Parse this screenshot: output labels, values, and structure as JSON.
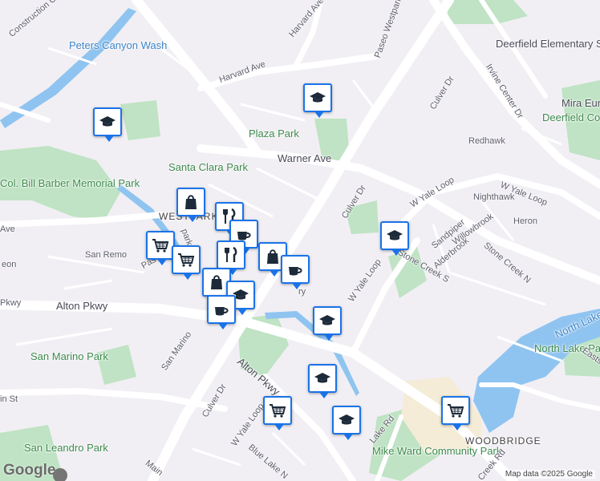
{
  "colors": {
    "background": "#f1eff4",
    "road": "#ffffff",
    "park": "#bfe3c4",
    "water": "#8fc4f0",
    "campus": "#f4ecd6",
    "pin_border": "#1a73e8",
    "pin_icon": "#1d2a3a"
  },
  "labels": {
    "peters_canyon": "Peters Canyon Wash",
    "construction": "Construction Ci",
    "harvard_ave_1": "Harvard Ave",
    "harvard_ave_2": "Harvard Ave",
    "paseo_westpark": "Paseo Westpark",
    "culver_dr_top": "Culver Dr",
    "irvine_center": "Irvine Center Dr",
    "deerfield_school": "Deerfield Elementary School",
    "mira_school": "Mira European Sc",
    "deerfield_park": "Deerfield Community Park",
    "redhawk": "Redhawk",
    "plaza_park": "Plaza Park",
    "warner_ave": "Warner Ave",
    "santa_clara_park": "Santa Clara Park",
    "col_bill_park": "Col. Bill Barber Memorial Park",
    "westpark": "WESTPARK",
    "ave_left": "Ave",
    "culver_dr_mid": "Culver Dr",
    "w_yale_loop_top": "W Yale Loop",
    "w_yale_loop_right": "W Yale Loop",
    "nighthawk": "Nighthawk",
    "sandpiper": "Sandpiper",
    "willowbrook": "Willowbrook",
    "heron": "Heron",
    "alderbrook": "Alderbrook",
    "stone_creek_s": "Stone Creek S",
    "stone_creek_n": "Stone Creek N",
    "san_remo": "San Remo",
    "paseo_left": "Pas",
    "leon": "eon",
    "w_yale_loop_mid": "W Yale Loop",
    "alton_pkwy_left": "Alton Pkwy",
    "alton_pkwy_mid": "Alton Pkwy",
    "pkwy": "Pkwy",
    "north_lake": "North Lake",
    "north_lake_park": "North Lake Park",
    "san_marino_park": "San Marino Park",
    "san_marino": "San Marino",
    "culver_dr_low": "Culver Dr",
    "eastshore": "Eastsh",
    "w_yale_loop_low": "W Yale Loop",
    "lake_rd": "Lake Rd",
    "woodbridge": "WOODBRIDGE",
    "mike_ward_park": "Mike Ward Community Park",
    "blue_lake": "Blue Lake N",
    "san_leandro_park": "San Leandro Park",
    "main": "Main",
    "in_st": "in St",
    "creek_rd": "Creek Rd",
    "park_frag": "park",
    "ry": "ry"
  },
  "markers": [
    {
      "icon": "school-icon",
      "name": "school"
    },
    {
      "icon": "school-icon",
      "name": "school"
    },
    {
      "icon": "shopping-bag-icon",
      "name": "shopping"
    },
    {
      "icon": "restaurant-icon",
      "name": "restaurant"
    },
    {
      "icon": "cafe-icon",
      "name": "cafe"
    },
    {
      "icon": "grocery-cart-icon",
      "name": "grocery"
    },
    {
      "icon": "grocery-cart-icon",
      "name": "grocery"
    },
    {
      "icon": "restaurant-icon",
      "name": "restaurant"
    },
    {
      "icon": "shopping-bag-icon",
      "name": "shopping"
    },
    {
      "icon": "cafe-icon",
      "name": "cafe"
    },
    {
      "icon": "shopping-bag-icon",
      "name": "shopping"
    },
    {
      "icon": "school-icon",
      "name": "school"
    },
    {
      "icon": "cafe-icon",
      "name": "cafe"
    },
    {
      "icon": "school-icon",
      "name": "school"
    },
    {
      "icon": "school-icon",
      "name": "school"
    },
    {
      "icon": "school-icon",
      "name": "school"
    },
    {
      "icon": "grocery-cart-icon",
      "name": "grocery"
    },
    {
      "icon": "school-icon",
      "name": "school"
    },
    {
      "icon": "grocery-cart-icon",
      "name": "grocery"
    }
  ],
  "attribution": "Map data ©2025 Google",
  "logo": "Google"
}
